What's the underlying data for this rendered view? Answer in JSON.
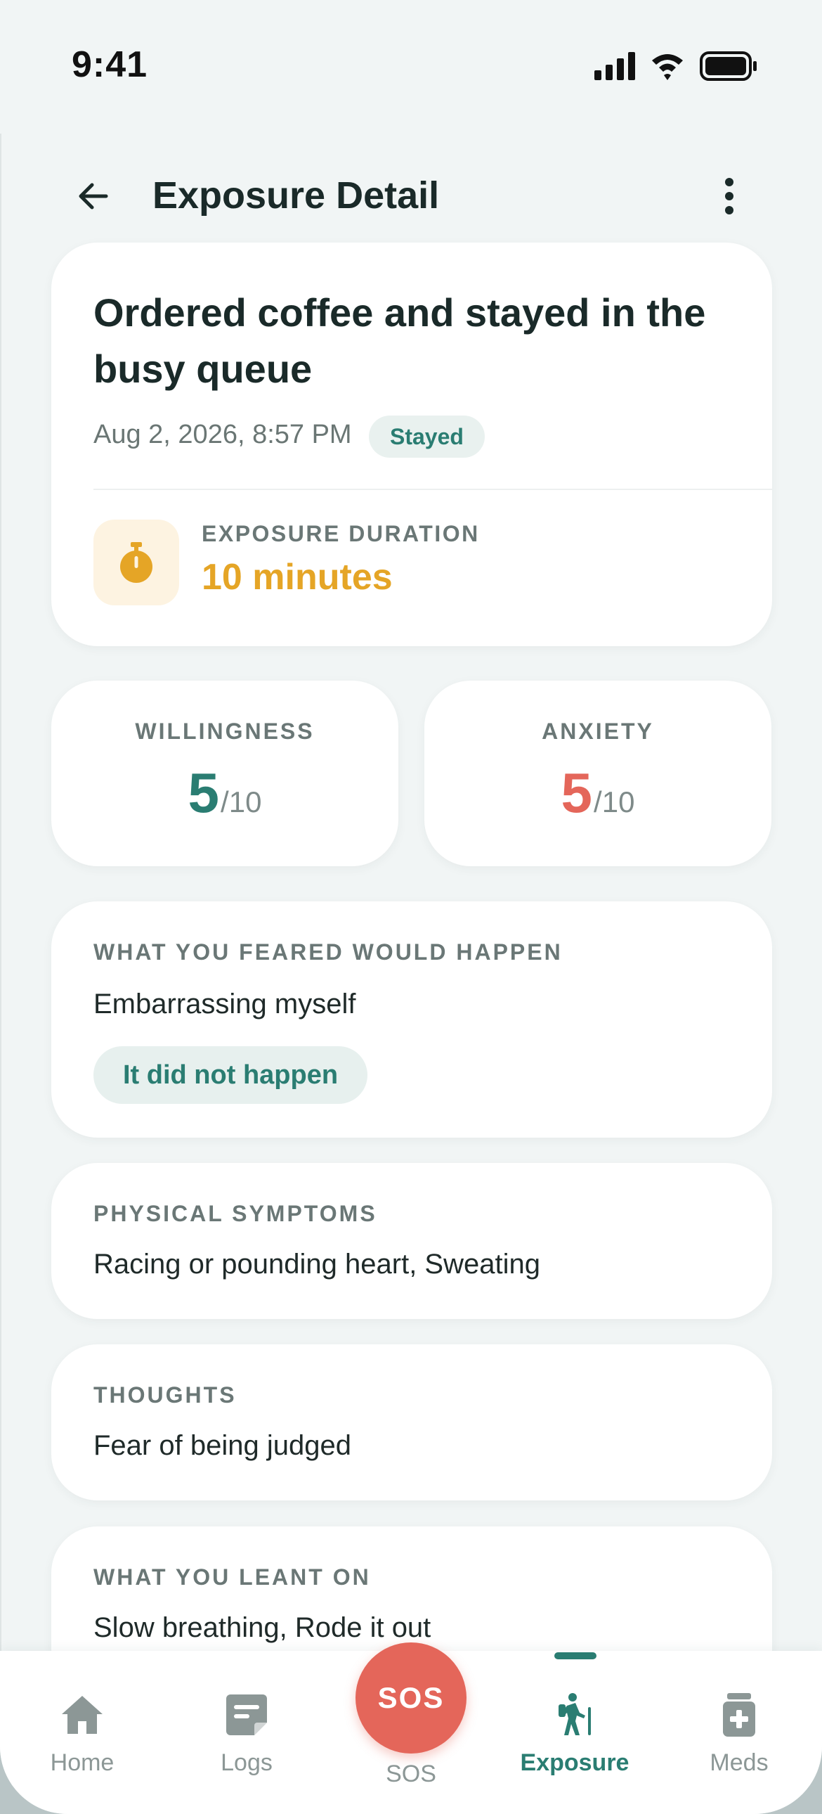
{
  "status_bar": {
    "time": "9:41",
    "icons": [
      "cellular-signal-icon",
      "wifi-icon",
      "battery-icon"
    ]
  },
  "header": {
    "back_icon": "arrow-left-icon",
    "title": "Exposure Detail",
    "more_icon": "more-vertical-icon"
  },
  "entry": {
    "title": "Ordered coffee and stayed in the busy queue",
    "date": "Aug 2, 2026, 8:57 PM",
    "status": "Stayed",
    "duration_icon": "stopwatch-icon",
    "duration_label": "EXPOSURE DURATION",
    "duration_value": "10 minutes"
  },
  "scores": {
    "willingness": {
      "label": "WILLINGNESS",
      "value": "5",
      "max": "/10"
    },
    "anxiety": {
      "label": "ANXIETY",
      "value": "5",
      "max": "/10"
    }
  },
  "feared": {
    "label": "WHAT YOU FEARED WOULD HAPPEN",
    "value": "Embarrassing myself",
    "outcome": "It did not happen"
  },
  "symptoms": {
    "label": "PHYSICAL SYMPTOMS",
    "value": "Racing or pounding heart, Sweating"
  },
  "thoughts": {
    "label": "THOUGHTS",
    "value": "Fear of being judged"
  },
  "coping": {
    "label": "WHAT YOU LEANT ON",
    "value": "Slow breathing, Rode it out"
  },
  "nav": {
    "items": [
      {
        "label": "Home",
        "icon": "home-icon"
      },
      {
        "label": "Logs",
        "icon": "logs-icon"
      },
      {
        "label": "SOS",
        "icon": "sos-button"
      },
      {
        "label": "Exposure",
        "icon": "hiker-icon"
      },
      {
        "label": "Meds",
        "icon": "medication-icon"
      }
    ],
    "sos_button_text": "SOS",
    "active": "Exposure"
  },
  "colors": {
    "background": "#f1f5f5",
    "card": "#ffffff",
    "primary": "#2a7d72",
    "duration": "#e5a526",
    "anxiety": "#e4665a",
    "sos": "#e4665a",
    "muted_text": "#6a7776"
  }
}
